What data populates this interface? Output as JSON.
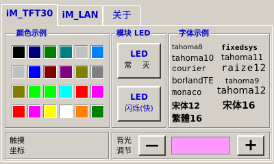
{
  "tabs": [
    {
      "label": "iM_TFT30"
    },
    {
      "label": "iM_LAN"
    },
    {
      "label": "关于"
    }
  ],
  "color_group": {
    "title": "颜色示例",
    "rows": [
      [
        "#000000",
        "#000080",
        "#008000",
        "#008080",
        "#c0c0c0",
        "#0080ff"
      ],
      [
        "#c0c0c0",
        "#0000ff",
        "#800000",
        "#800080",
        "#808000",
        "#808080"
      ],
      [
        "#808000",
        "#00ff00",
        "#00ff00",
        "#00ffff",
        "#ff0000",
        "#ff00ff"
      ],
      [
        "#ff0000",
        "#ff00ff",
        "#ffff00",
        "#ffffff",
        "#ff8000",
        "#008000"
      ]
    ]
  },
  "led_group": {
    "title": "模块 LED",
    "steady": {
      "line1": "LED",
      "line2": "常 灭"
    },
    "flash": {
      "line1": "LED",
      "line2": "闪烁(快)"
    }
  },
  "font_group": {
    "title": "字体示例",
    "samples": [
      {
        "text": "tahoma8"
      },
      {
        "text": "fixedsys"
      },
      {
        "text": "tahoma10"
      },
      {
        "text": "tahoma11"
      },
      {
        "text": "courier"
      },
      {
        "text": "raize12"
      },
      {
        "text": "borlandTE"
      },
      {
        "text": "tahoma9"
      },
      {
        "text": "monaco"
      },
      {
        "text": "tahoma12"
      },
      {
        "text": "宋体12"
      },
      {
        "text": "宋体16"
      },
      {
        "text": "繁體16"
      }
    ]
  },
  "touch": {
    "line1": "触摸",
    "line2": "坐标"
  },
  "backlight": {
    "line1": "背光",
    "line2": "调节",
    "minus": "—",
    "plus": "+",
    "bar_color": "#ff99ff"
  }
}
